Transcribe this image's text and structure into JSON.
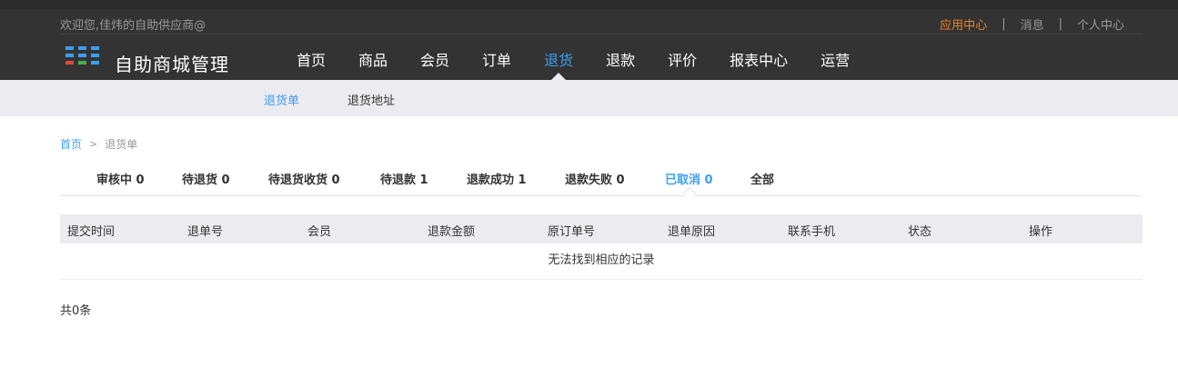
{
  "topbar": {
    "welcome": "欢迎您,佳炜的自助供应商@",
    "links": [
      "应用中心",
      "消息",
      "个人中心"
    ],
    "separator": "|"
  },
  "brand": {
    "title": "自助商城管理"
  },
  "colors": {
    "accent": "#3b9ff5",
    "orange": "#f0821e",
    "header": "#333333",
    "subnav_bg": "#ecebf0"
  },
  "main_nav": [
    "首页",
    "商品",
    "会员",
    "订单",
    "退货",
    "退款",
    "评价",
    "报表中心",
    "运营"
  ],
  "sub_nav": [
    "退货单",
    "退货地址"
  ],
  "breadcrumb": {
    "home": "首页",
    "separator": ">",
    "current": "退货单"
  },
  "status_tabs": [
    "审核中 0",
    "待退货 0",
    "待退货收货 0",
    "待退款 1",
    "退款成功 1",
    "退款失败 0",
    "已取消 0",
    "全部"
  ],
  "table": {
    "columns": [
      "提交时间",
      "退单号",
      "会员",
      "退款金额",
      "原订单号",
      "退单原因",
      "联系手机",
      "状态",
      "操作"
    ],
    "empty_text": "无法找到相应的记录"
  },
  "footer": {
    "total": "共0条"
  }
}
